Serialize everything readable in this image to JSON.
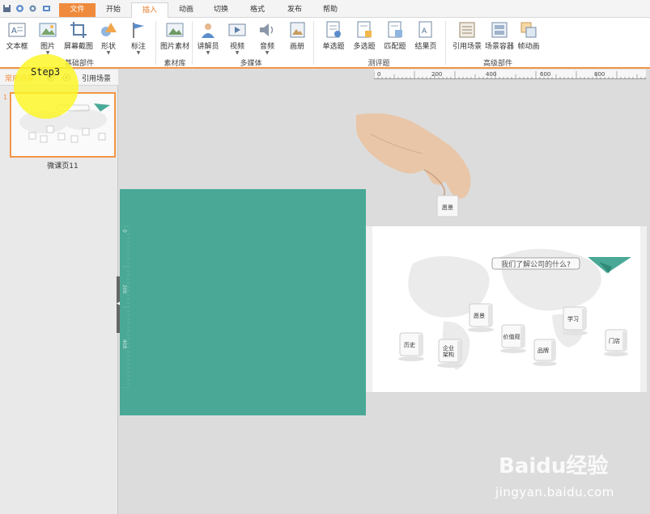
{
  "tabs": [
    {
      "label": "文件"
    },
    {
      "label": "开始"
    },
    {
      "label": "插入"
    },
    {
      "label": "动画"
    },
    {
      "label": "切换"
    },
    {
      "label": "格式"
    },
    {
      "label": "发布"
    },
    {
      "label": "帮助"
    }
  ],
  "ribbon": {
    "buttons": [
      "文本框",
      "图片",
      "屏幕截图",
      "形状",
      "标注",
      "图片素材",
      "讲解员",
      "视频",
      "音频",
      "画册",
      "单选题",
      "多选题",
      "匹配题",
      "结果页",
      "引用场景",
      "场景容器",
      "帧动画"
    ],
    "groups": [
      "基础部件",
      "素材库",
      "多媒体",
      "测评题",
      "高级部件"
    ]
  },
  "left_panel": {
    "tab_common": "常用场景",
    "tab_ref": "引用场景",
    "slide_number": "1",
    "slide_label": "微课页11"
  },
  "ruler": {
    "h_labels": [
      "0",
      "200",
      "400",
      "600",
      "800"
    ],
    "v_labels": [
      "0",
      "200",
      "400"
    ]
  },
  "slide": {
    "question": "我们了解公司的什么?",
    "cubes": [
      "愿景",
      "历史",
      "企业\n架构",
      "价值观",
      "品牌",
      "学习",
      "门店"
    ]
  },
  "annotation": {
    "step": "Step3"
  },
  "watermark": {
    "brand": "Baidu经验",
    "url": "jingyan.baidu.com"
  },
  "colors": {
    "accent": "#f29545",
    "green": "#4aa996",
    "highlight": "#fcf628"
  }
}
